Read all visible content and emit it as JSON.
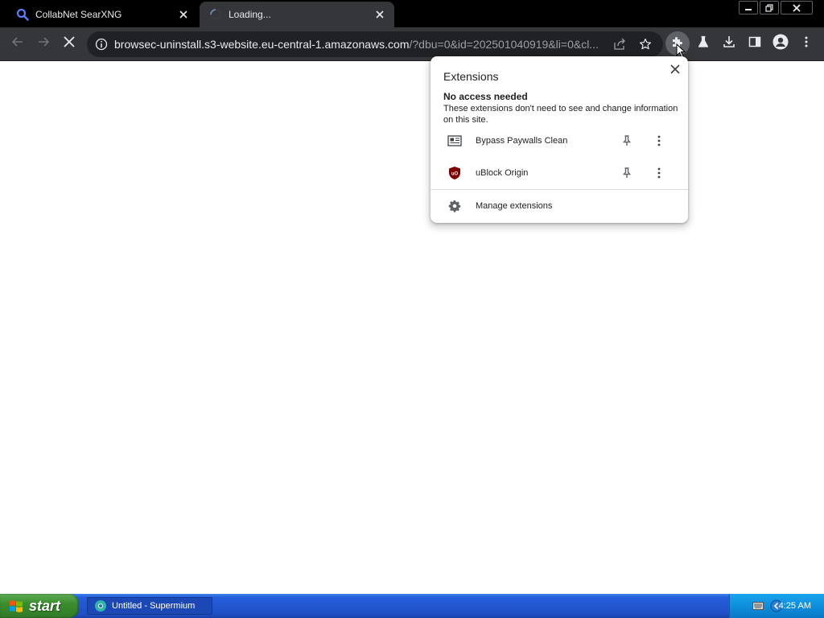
{
  "tabs": [
    {
      "title": "CollabNet SearXNG",
      "icon": "search-icon"
    },
    {
      "title": "Loading...",
      "icon": "loading-spinner-icon"
    }
  ],
  "address_bar": {
    "url_host": "browsec-uninstall.s3-website.eu-central-1.amazonaws.com",
    "url_rest": "/?dbu=0&id=202501040919&li=0&cl..."
  },
  "extensions_popup": {
    "title": "Extensions",
    "section_heading": "No access needed",
    "section_description": "These extensions don't need to see and change information on this site.",
    "items": [
      {
        "name": "Bypass Paywalls Clean",
        "icon": "newspaper-icon"
      },
      {
        "name": "uBlock Origin",
        "icon": "ublock-shield-icon"
      }
    ],
    "manage_label": "Manage extensions"
  },
  "taskbar": {
    "start_label": "start",
    "task_item": "Untitled - Supermium",
    "clock": "4:25 AM"
  },
  "colors": {
    "tab_strip": "#000000",
    "toolbar": "#35363a",
    "omnibox": "#202124",
    "popup_bg": "#ffffff",
    "taskbar_blue": "#245edb",
    "start_green": "#3c8d2f"
  }
}
